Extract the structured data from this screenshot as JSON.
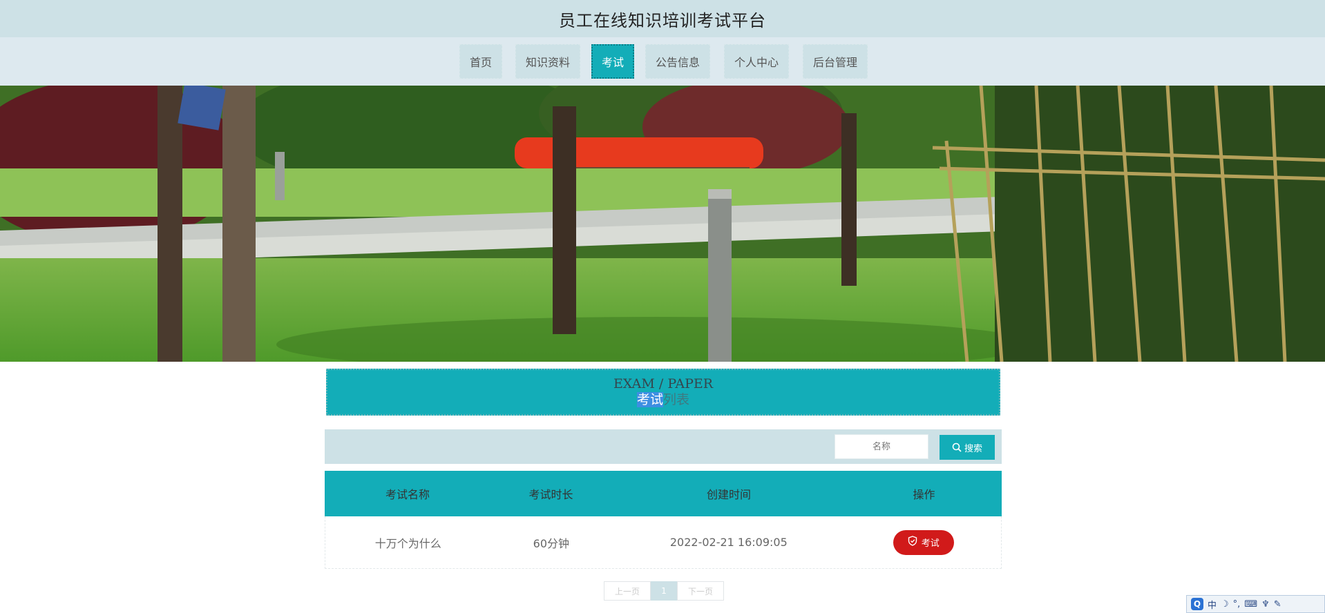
{
  "site": {
    "title": "员工在线知识培训考试平台"
  },
  "nav": {
    "items": [
      {
        "label": "首页"
      },
      {
        "label": "知识资料"
      },
      {
        "label": "考试"
      },
      {
        "label": "公告信息"
      },
      {
        "label": "个人中心"
      },
      {
        "label": "后台管理"
      }
    ],
    "active_index": 2
  },
  "list_header": {
    "en": "EXAM / PAPER",
    "cn_selected": "考试",
    "cn_rest": "列表"
  },
  "search": {
    "placeholder": "名称",
    "button_label": "搜索"
  },
  "table": {
    "headers": [
      "考试名称",
      "考试时长",
      "创建时间",
      "操作"
    ],
    "rows": [
      {
        "name": "十万个为什么",
        "duration": "60分钟",
        "created": "2022-02-21 16:09:05",
        "action": "考试"
      }
    ]
  },
  "pagination": {
    "prev": "上一页",
    "current": "1",
    "next": "下一页"
  },
  "ime": {
    "mode": "中"
  },
  "colors": {
    "accent": "#13adb8",
    "nav_bg": "#cde1e6",
    "danger": "#d11a1a"
  }
}
